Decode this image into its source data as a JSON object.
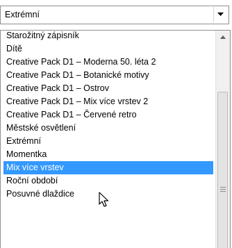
{
  "combo": {
    "selected_value": "Extrémní",
    "dropdown_icon": "chevron-down-icon"
  },
  "list": {
    "items": [
      "Starožitný zápisník",
      "Dítě",
      "Creative Pack D1 – Moderna 50. léta 2",
      "Creative Pack D1 – Botanické motivy",
      "Creative Pack D1 – Ostrov",
      "Creative Pack D1 – Mix více vrstev 2",
      "Creative Pack D1 – Červené retro",
      "Městské osvětlení",
      "Extrémní",
      "Momentka",
      "Mix více vrstev",
      "Roční období",
      "Posuvné dlaždice"
    ],
    "highlighted_item": "Mix více vrstev",
    "highlight_color": "#3399ff"
  },
  "scrollbar": {
    "up_icon": "chevron-up-icon",
    "grip_icon": "scroll-grip-icon"
  },
  "cursor": {
    "icon": "mouse-pointer-icon"
  }
}
